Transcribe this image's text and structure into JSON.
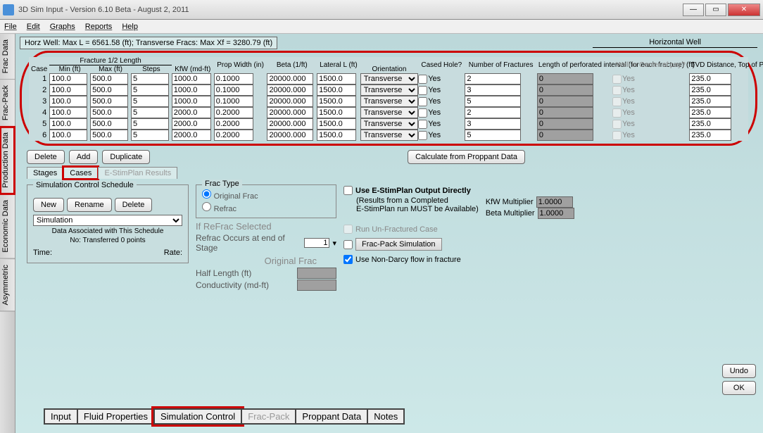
{
  "window": {
    "title": "3D Sim Input - Version 6.10 Beta - August 2, 2011"
  },
  "menu": [
    "File",
    "Edit",
    "Graphs",
    "Reports",
    "Help"
  ],
  "sidetabs": [
    "Frac Data",
    "Frac-Pack",
    "Production Data",
    "Economic Data",
    "Asymmetric"
  ],
  "info_line": "Horz Well: Max L = 6561.58 (ft); Transverse Fracs: Max Xf = 3280.79 (ft)",
  "hw_label": "Horizontal Well",
  "headers": {
    "group_frac": "Fracture 1/2 Length",
    "case": "Case",
    "min": "Min (ft)",
    "max": "Max (ft)",
    "steps": "Steps",
    "kfw": "KfW (md-ft)",
    "propw": "Prop Width (in)",
    "beta": "Beta (1/ft)",
    "lateral": "Lateral L (ft)",
    "orient": "Orientation",
    "cased": "Cased Hole?",
    "numfrac": "Number of Fractures",
    "perfint": "Length of perforated interval (for each fracture) (ft)",
    "wellin": "Well in Center of pay?",
    "tvd": "TVD Distance, Top of Pay to Well (ft)"
  },
  "rows": [
    {
      "case": "1",
      "min": "100.0",
      "max": "500.0",
      "steps": "5",
      "kfw": "1000.0",
      "propw": "0.1000",
      "beta": "20000.000",
      "lateral": "1500.0",
      "orient": "Transverse",
      "cased": "Yes",
      "numfrac": "2",
      "perfint": "0",
      "wellin": "Yes",
      "tvd": "235.0"
    },
    {
      "case": "2",
      "min": "100.0",
      "max": "500.0",
      "steps": "5",
      "kfw": "1000.0",
      "propw": "0.1000",
      "beta": "20000.000",
      "lateral": "1500.0",
      "orient": "Transverse",
      "cased": "Yes",
      "numfrac": "3",
      "perfint": "0",
      "wellin": "Yes",
      "tvd": "235.0"
    },
    {
      "case": "3",
      "min": "100.0",
      "max": "500.0",
      "steps": "5",
      "kfw": "1000.0",
      "propw": "0.1000",
      "beta": "20000.000",
      "lateral": "1500.0",
      "orient": "Transverse",
      "cased": "Yes",
      "numfrac": "5",
      "perfint": "0",
      "wellin": "Yes",
      "tvd": "235.0"
    },
    {
      "case": "4",
      "min": "100.0",
      "max": "500.0",
      "steps": "5",
      "kfw": "2000.0",
      "propw": "0.2000",
      "beta": "20000.000",
      "lateral": "1500.0",
      "orient": "Transverse",
      "cased": "Yes",
      "numfrac": "2",
      "perfint": "0",
      "wellin": "Yes",
      "tvd": "235.0"
    },
    {
      "case": "5",
      "min": "100.0",
      "max": "500.0",
      "steps": "5",
      "kfw": "2000.0",
      "propw": "0.2000",
      "beta": "20000.000",
      "lateral": "1500.0",
      "orient": "Transverse",
      "cased": "Yes",
      "numfrac": "3",
      "perfint": "0",
      "wellin": "Yes",
      "tvd": "235.0"
    },
    {
      "case": "6",
      "min": "100.0",
      "max": "500.0",
      "steps": "5",
      "kfw": "2000.0",
      "propw": "0.2000",
      "beta": "20000.000",
      "lateral": "1500.0",
      "orient": "Transverse",
      "cased": "Yes",
      "numfrac": "5",
      "perfint": "0",
      "wellin": "Yes",
      "tvd": "235.0"
    }
  ],
  "btns": {
    "delete": "Delete",
    "add": "Add",
    "duplicate": "Duplicate",
    "calc": "Calculate from Proppant Data"
  },
  "subtabs": {
    "stages": "Stages",
    "cases": "Cases",
    "estim": "E-StimPlan Results"
  },
  "scs": {
    "title": "Simulation Control Schedule",
    "new": "New",
    "rename": "Rename",
    "delete": "Delete",
    "sel": "Simulation",
    "assoc": "Data Associated with This Schedule",
    "none": "No: Transferred 0 points",
    "time": "Time:",
    "rate": "Rate:"
  },
  "fractype": {
    "legend": "Frac Type",
    "orig": "Original Frac",
    "refrac": "Refrac",
    "ifsel": "If ReFrac Selected",
    "occurs": "Refrac Occurs at end of Stage",
    "stage": "1",
    "ofhdr": "Original Frac",
    "half": "Half Length (ft)",
    "cond": "Conductivity (md-ft)"
  },
  "right": {
    "use_estim": "Use E-StimPlan Output Directly",
    "note1": "(Results from a Completed",
    "note2": "E-StimPlan run MUST be Available)",
    "kfwm": "KfW  Multiplier",
    "kfwv": "1.0000",
    "betam": "Beta Multiplier",
    "betav": "1.0000",
    "rununf": "Run Un-Fractured Case",
    "fp": "Frac-Pack Simulation",
    "nondarcy": "Use Non-Darcy flow in fracture"
  },
  "corner": {
    "undo": "Undo",
    "ok": "OK"
  },
  "bottomtabs": [
    "Input",
    "Fluid Properties",
    "Simulation Control",
    "Frac-Pack",
    "Proppant Data",
    "Notes"
  ]
}
